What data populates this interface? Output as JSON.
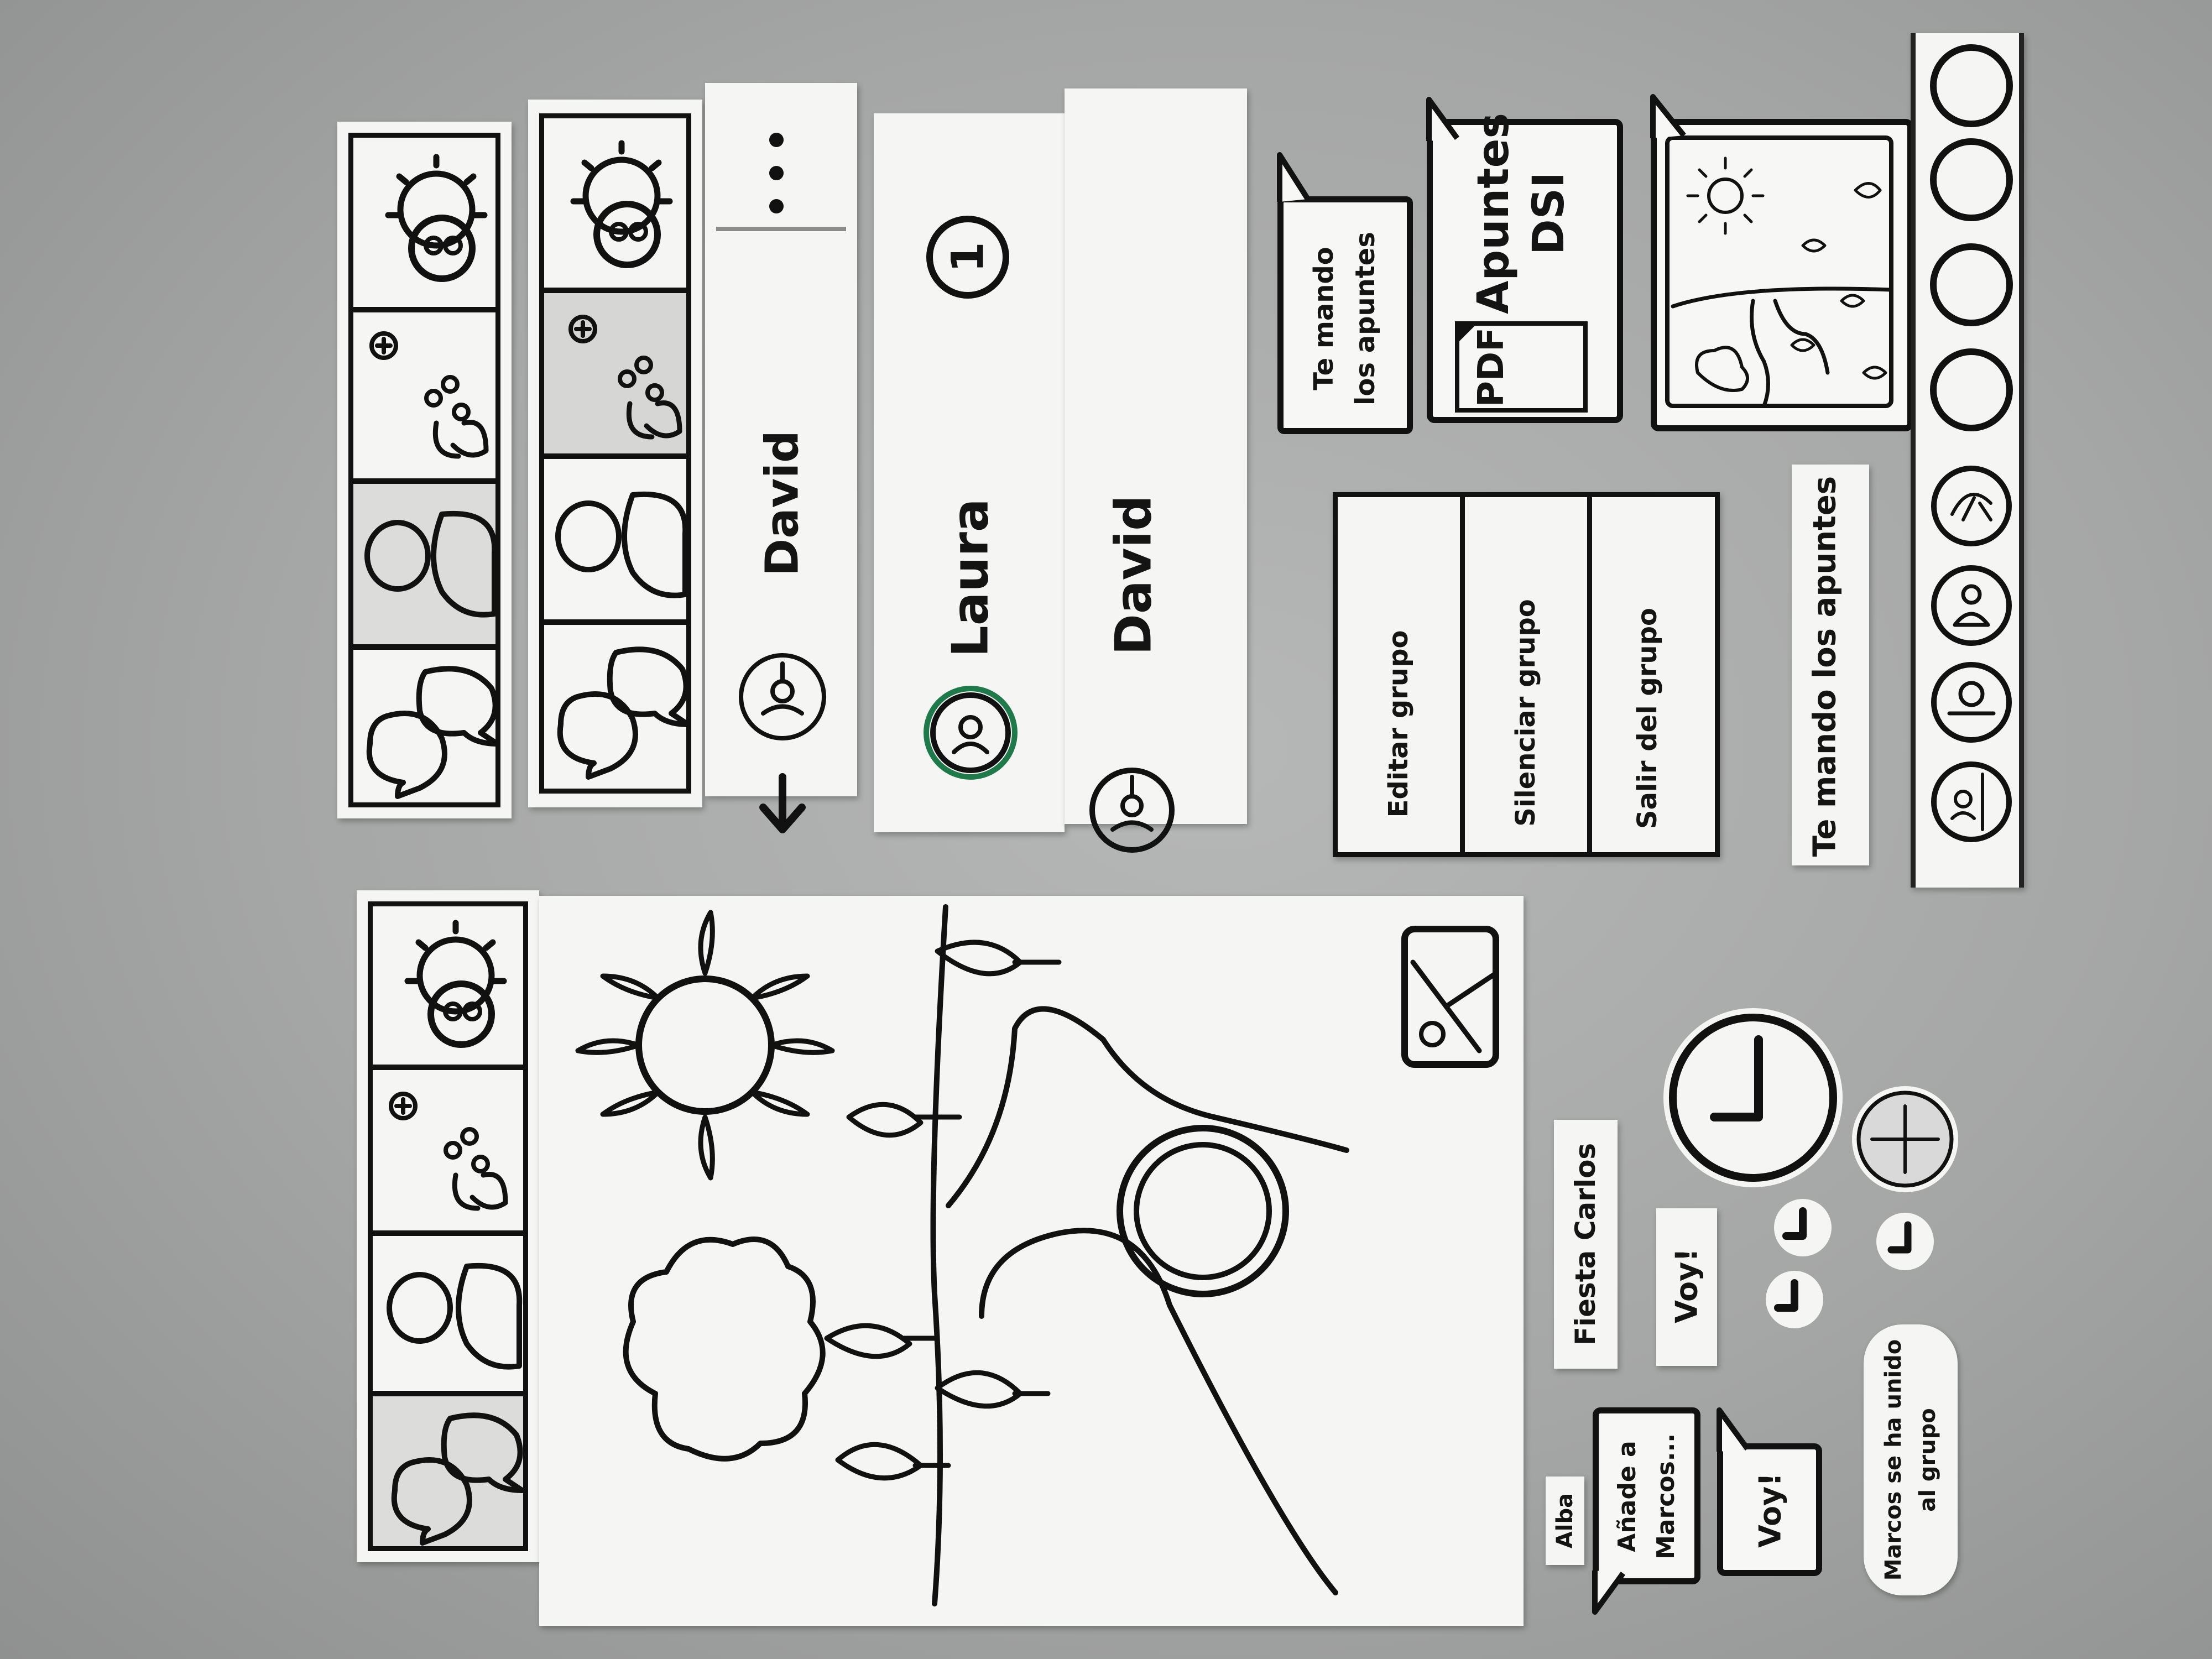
{
  "top_bars": {
    "contacts_header": {
      "name": "David"
    },
    "chat_list": [
      {
        "name": "Laura",
        "unread_count": "1"
      },
      {
        "name": "David"
      }
    ]
  },
  "bubbles": {
    "message_1": "Te mando\nlos apuntes",
    "file_title": "Apuntes\nDSI",
    "file_badge": "PDF",
    "preview_text": "Te mando los apuntes"
  },
  "group_menu": {
    "items": [
      "Editar grupo",
      "Silenciar grupo",
      "Salir del grupo"
    ]
  },
  "bottom_pieces": {
    "event_title": "Fiesta Carlos",
    "event_reply": "Voy!",
    "sender_name": "Alba",
    "message_2": "Añade a\nMarcos...",
    "message_3": "Voy!",
    "system_message": "Marcos se ha unido\nal grupo"
  },
  "nav_icons": [
    "chat-bubbles-icon",
    "contacts-icon",
    "add-group-icon",
    "settings-profile-icon"
  ],
  "colors": {
    "paper": "#f5f5f3",
    "ink": "#111111",
    "table": "#a7a8a8",
    "unread_ring": "#1f7a4a"
  }
}
